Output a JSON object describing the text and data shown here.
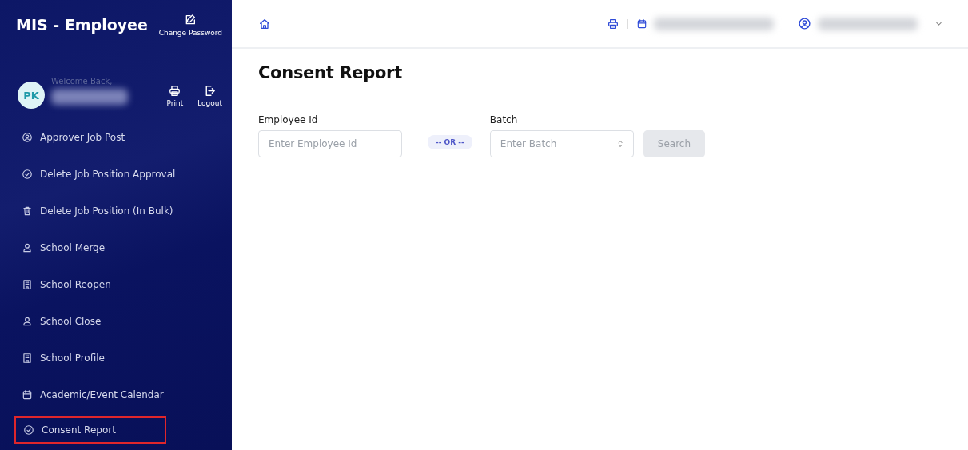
{
  "sidebar": {
    "title": "MIS - Employee",
    "change_password": "Change Password",
    "avatar": "PK",
    "welcome": "Welcome Back,",
    "actions": [
      {
        "kind": "printer",
        "label": "Print"
      },
      {
        "kind": "logout",
        "label": "Logout"
      }
    ],
    "items": [
      {
        "kind": "user-circle",
        "label": "Approver Job Post",
        "highlighted": false
      },
      {
        "kind": "check-circle",
        "label": "Delete Job Position Approval",
        "highlighted": false
      },
      {
        "kind": "trash",
        "label": "Delete Job Position (In Bulk)",
        "highlighted": false
      },
      {
        "kind": "user",
        "label": "School Merge",
        "highlighted": false
      },
      {
        "kind": "building",
        "label": "School Reopen",
        "highlighted": false
      },
      {
        "kind": "user",
        "label": "School Close",
        "highlighted": false
      },
      {
        "kind": "building",
        "label": "School Profile",
        "highlighted": false
      },
      {
        "kind": "calendar",
        "label": "Academic/Event Calendar",
        "highlighted": false
      },
      {
        "kind": "check-circle",
        "label": "Consent Report",
        "highlighted": true
      }
    ]
  },
  "page": {
    "title": "Consent Report",
    "employee_field": {
      "label": "Employee Id",
      "placeholder": "Enter Employee Id"
    },
    "separator": "-- OR --",
    "batch_field": {
      "label": "Batch",
      "placeholder": "Enter Batch"
    },
    "search_button": {
      "label": "Search",
      "disabled": true
    }
  }
}
